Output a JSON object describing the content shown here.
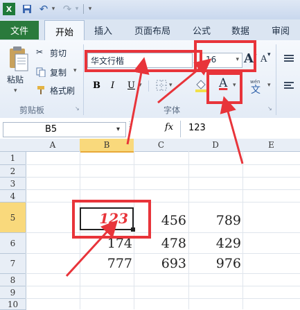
{
  "quick_access": {
    "app_icon": "excel-logo-icon",
    "save_icon": "save-icon",
    "undo_icon": "undo-icon",
    "redo_icon": "redo-icon",
    "customize_icon": "customize-toolbar-icon"
  },
  "tabs": [
    {
      "label": "文件"
    },
    {
      "label": "开始"
    },
    {
      "label": "插入"
    },
    {
      "label": "页面布局"
    },
    {
      "label": "公式"
    },
    {
      "label": "数据"
    },
    {
      "label": "审阅"
    }
  ],
  "clipboard": {
    "paste_label": "粘贴",
    "cut_label": "剪切",
    "copy_label": "复制",
    "format_painter_label": "格式刷",
    "group_label": "剪贴板"
  },
  "font": {
    "font_name": "华文行楷",
    "font_size": "16",
    "bold": "B",
    "italic": "I",
    "underline": "U",
    "font_color_glyph": "A",
    "grow_glyph": "A",
    "shrink_glyph": "A",
    "group_label": "字体"
  },
  "formula_bar": {
    "name_box": "B5",
    "fx": "fx",
    "value": "123"
  },
  "columns": [
    "A",
    "B",
    "C",
    "D",
    "E"
  ],
  "rows": [
    "1",
    "2",
    "3",
    "4",
    "5",
    "6",
    "7",
    "8",
    "9",
    "10"
  ],
  "cells": {
    "b5": "123",
    "c5": "456",
    "d5": "789",
    "b6": "174",
    "c6": "478",
    "d6": "429",
    "b7": "777",
    "c7": "693",
    "d7": "976"
  },
  "colors": {
    "annotation_red": "#e8343a",
    "file_tab_green": "#2a7a3c",
    "selected_header": "#f9d97c"
  }
}
